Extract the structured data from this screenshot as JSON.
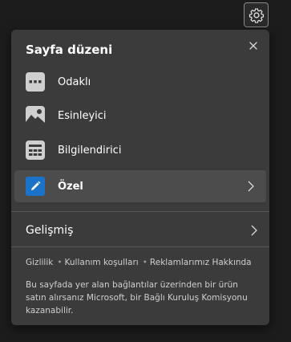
{
  "panel": {
    "title": "Sayfa düzeni",
    "layouts": [
      {
        "label": "Odaklı",
        "icon": "focused-layout-icon"
      },
      {
        "label": "Esinleyici",
        "icon": "inspirational-layout-icon"
      },
      {
        "label": "Bilgilendirici",
        "icon": "informational-layout-icon"
      },
      {
        "label": "Özel",
        "icon": "pencil-icon",
        "selected": true
      }
    ],
    "advanced_label": "Gelişmiş",
    "links": [
      "Gizlilik",
      "Kullanım koşulları",
      "Reklamlarımız Hakkında"
    ],
    "disclaimer": "Bu sayfada yer alan bağlantılar üzerinden bir ürün satın alırsanız Microsoft, bir Bağlı Kuruluş Komisyonu kazanabilir."
  },
  "colors": {
    "background": "#1c1c1c",
    "panel": "#3b3b3b",
    "selected_row": "#4c4c4c",
    "accent": "#1a73c9"
  }
}
